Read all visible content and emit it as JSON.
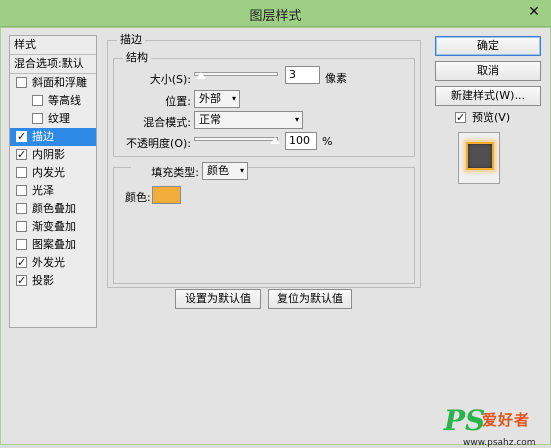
{
  "window": {
    "title": "图层样式",
    "close_symbol": "✕"
  },
  "style_list": {
    "header": "样式",
    "blend_options": "混合选项:默认",
    "items": [
      {
        "label": "斜面和浮雕",
        "checked": false,
        "indent": false,
        "selected": false
      },
      {
        "label": "等高线",
        "checked": false,
        "indent": true,
        "selected": false
      },
      {
        "label": "纹理",
        "checked": false,
        "indent": true,
        "selected": false
      },
      {
        "label": "描边",
        "checked": true,
        "indent": false,
        "selected": true
      },
      {
        "label": "内阴影",
        "checked": true,
        "indent": false,
        "selected": false
      },
      {
        "label": "内发光",
        "checked": false,
        "indent": false,
        "selected": false
      },
      {
        "label": "光泽",
        "checked": false,
        "indent": false,
        "selected": false
      },
      {
        "label": "颜色叠加",
        "checked": false,
        "indent": false,
        "selected": false
      },
      {
        "label": "渐变叠加",
        "checked": false,
        "indent": false,
        "selected": false
      },
      {
        "label": "图案叠加",
        "checked": false,
        "indent": false,
        "selected": false
      },
      {
        "label": "外发光",
        "checked": true,
        "indent": false,
        "selected": false
      },
      {
        "label": "投影",
        "checked": true,
        "indent": false,
        "selected": false
      }
    ]
  },
  "stroke": {
    "section_title": "描边",
    "structure_title": "结构",
    "size_label": "大小(S):",
    "size_value": "3",
    "size_unit": "像素",
    "size_fraction": 0.02,
    "position_label": "位置:",
    "position_value": "外部",
    "blend_mode_label": "混合模式:",
    "blend_mode_value": "正常",
    "opacity_label": "不透明度(O):",
    "opacity_value": "100",
    "opacity_unit": "%",
    "opacity_fraction": 1.0,
    "fill_type_label": "填充类型:",
    "fill_type_value": "颜色",
    "color_label": "颜色:",
    "color_value": "#f0ad3a",
    "set_default_button": "设置为默认值",
    "reset_default_button": "复位为默认值"
  },
  "buttons": {
    "ok": "确定",
    "cancel": "取消",
    "new_style": "新建样式(W)...",
    "preview_label": "预览(V)",
    "preview_checked": true
  },
  "watermark": {
    "ps": "PS",
    "name": "爱好者",
    "url": "www.psahz.com"
  },
  "colors": {
    "titlebar": "#9fcf86",
    "selection": "#2e8ae6",
    "stroke_color": "#f0ad3a"
  },
  "icons": {
    "check": "✓",
    "dropdown": "▾"
  }
}
